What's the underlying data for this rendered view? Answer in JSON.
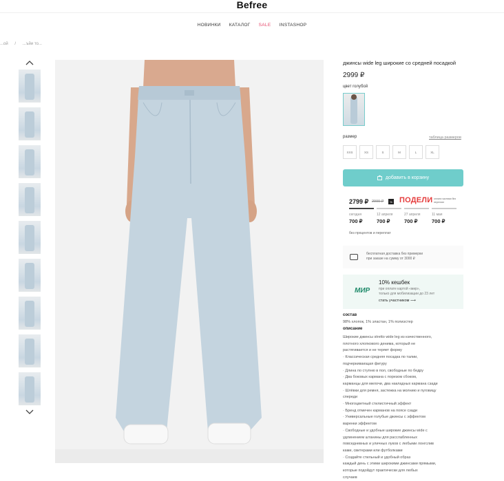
{
  "header": {
    "logo": "Befree",
    "nav": [
      "НОВИНКИ",
      "КАТАЛОГ",
      "SALE",
      "INSTASHOP"
    ]
  },
  "breadcrumb": [
    "...ой",
    "...ъйи то..."
  ],
  "product": {
    "title": "джинсы wide leg широкие со средней посадкой",
    "price": "2999 ₽",
    "color_label": "цвет голубой",
    "size_label": "размер",
    "size_guide": "таблица размеров",
    "sizes": [
      "XXS",
      "XS",
      "S",
      "M",
      "L",
      "XL"
    ],
    "cart_button": "добавить в корзину"
  },
  "podeli": {
    "price": "2799 ₽",
    "old_price": "2999 ₽",
    "logo": "ПОДЕЛИ",
    "note": "оплата частями без переплат",
    "payments": [
      {
        "date": "сегодня",
        "amount": "700 ₽"
      },
      {
        "date": "12 апреля",
        "amount": "700 ₽"
      },
      {
        "date": "27 апреля",
        "amount": "700 ₽"
      },
      {
        "date": "11 мая",
        "amount": "700 ₽"
      }
    ],
    "fee_text": "без процентов и переплат"
  },
  "gift": {
    "text": [
      "бесплатная доставка без примерки",
      "при заказе на сумму от 3000 ₽"
    ]
  },
  "mir": {
    "logo": "МИР",
    "title": "10% кешбек",
    "text": [
      "при оплате картой «мир»,",
      "только для мобилизации до 23 лет"
    ],
    "link": "стать участником ⟶"
  },
  "composition": {
    "title": "состав",
    "text": "98% хлопок, 1% эластан, 1% полиэстер"
  },
  "description": {
    "title": "описание",
    "lines": [
      "Широкие джинсы stretto wide leg из качественного,",
      "плотного хлопкового денима, который не",
      "растягивается и не теряет форму",
      "· Классическая средняя посадка по талии,",
      "подчеркивающая фигуру",
      "· Длина по ступню в пол, свободные по бедру",
      "· Два боковых кармана с порезом сбоком,",
      "карманцы для мелочи, два накладных кармана сзади",
      "· Шлёвки для ремня, застежка на молнию и пуговицу",
      "спереди",
      "· Многоцветный стилистичный эффект",
      "· Бренд отмечен карманов на поясе сзади",
      "· Универсальные голубые джинсы с эффектом",
      "варенки эффектом",
      "· Свободные и удобные широкие джинсы wide с",
      "удлинением штанины для расслабленных",
      "повседневных и уличных луков с любыми лонгслив",
      "ками, свитерами или футболками",
      "· Создайте стильный и удобный образ",
      "каждый день с этими широкими джинсами прямыми,",
      "которые подойдут практически для любых",
      "случаев"
    ]
  }
}
